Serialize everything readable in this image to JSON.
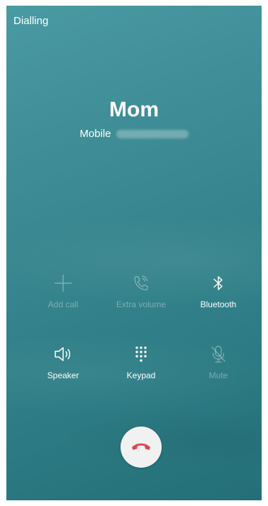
{
  "call": {
    "status": "Dialling",
    "contact_name": "Mom",
    "number_type": "Mobile",
    "number": "07000000000"
  },
  "controls": {
    "add_call": {
      "label": "Add call",
      "icon": "plus-icon",
      "enabled": false
    },
    "extra_volume": {
      "label": "Extra volume",
      "icon": "phone-volume-icon",
      "enabled": false
    },
    "bluetooth": {
      "label": "Bluetooth",
      "icon": "bluetooth-icon",
      "enabled": true
    },
    "speaker": {
      "label": "Speaker",
      "icon": "speaker-icon",
      "enabled": true
    },
    "keypad": {
      "label": "Keypad",
      "icon": "keypad-icon",
      "enabled": true
    },
    "mute": {
      "label": "Mute",
      "icon": "microphone-mute-icon",
      "enabled": false
    }
  },
  "end_call": {
    "icon": "end-call-icon",
    "color": "#e0474c"
  },
  "colors": {
    "background": "#3c8a93",
    "text": "#ffffff",
    "disabled_text": "rgba(255,255,255,0.35)"
  }
}
